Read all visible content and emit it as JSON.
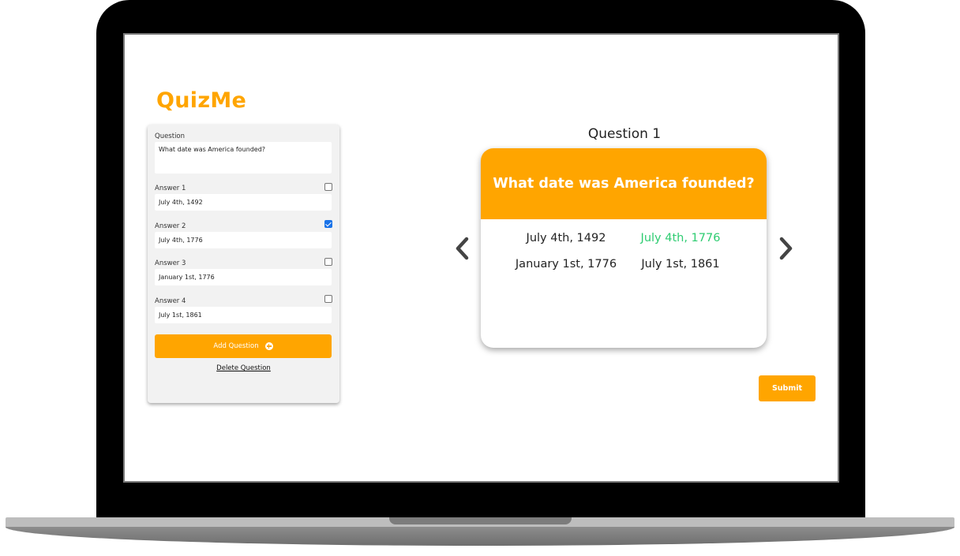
{
  "app": {
    "logo": "QuizMe"
  },
  "editor": {
    "question_label": "Question",
    "question_value": "What date was America founded?",
    "answers": [
      {
        "label": "Answer 1",
        "value": "July 4th, 1492",
        "checked": false
      },
      {
        "label": "Answer 2",
        "value": "July 4th, 1776",
        "checked": true
      },
      {
        "label": "Answer 3",
        "value": "January 1st, 1776",
        "checked": false
      },
      {
        "label": "Answer 4",
        "value": "July 1st, 1861",
        "checked": false
      }
    ],
    "add_button_label": "Add Question",
    "delete_link_label": "Delete Question"
  },
  "preview": {
    "heading": "Question 1",
    "question_text": "What date was America founded?",
    "answers": [
      {
        "text": "July 4th, 1492",
        "correct": false
      },
      {
        "text": "July 4th, 1776",
        "correct": true
      },
      {
        "text": "January 1st, 1776",
        "correct": false
      },
      {
        "text": "July 1st, 1861",
        "correct": false
      }
    ],
    "prev_icon": "chevron-left-icon",
    "next_icon": "chevron-right-icon"
  },
  "submit_label": "Submit",
  "colors": {
    "accent": "#ffa500",
    "correct": "#2ecc71",
    "checkbox_checked": "#1a73e8"
  }
}
